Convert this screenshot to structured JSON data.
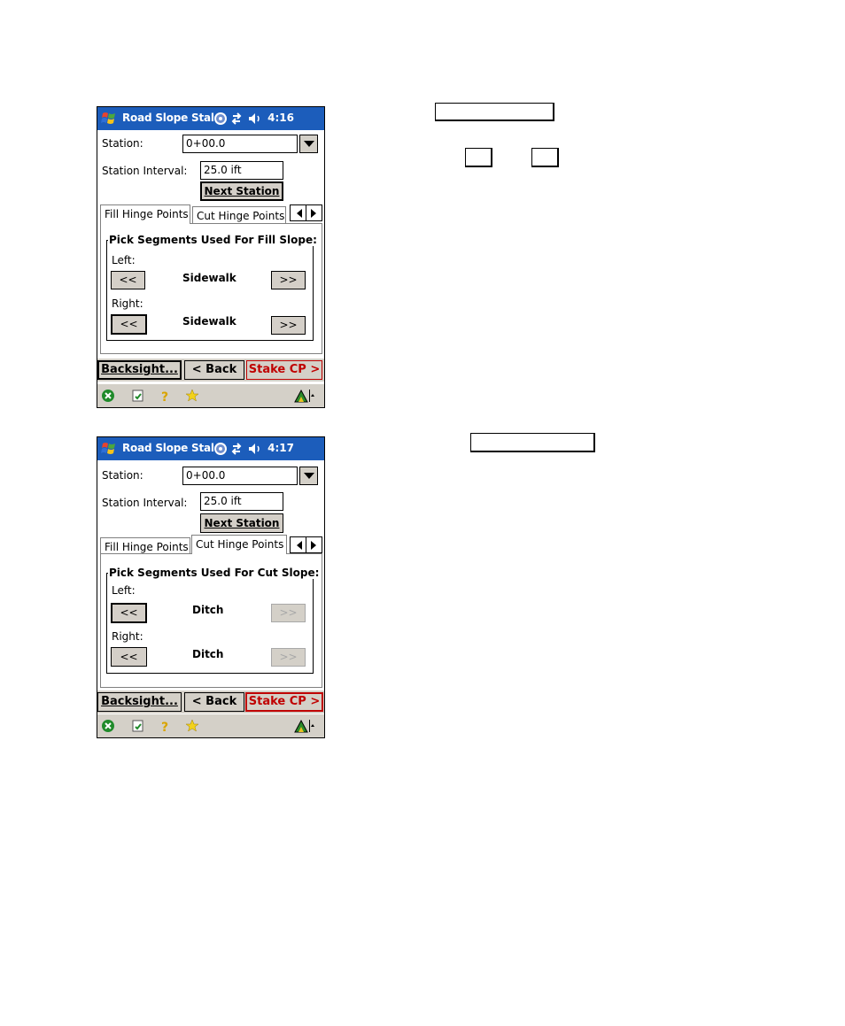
{
  "colors": {
    "titlebar": "#1c5dbb",
    "button_face": "#d4cfc8",
    "stake_text": "#c00000"
  },
  "screens": [
    {
      "app_title": "Road Slope Stal",
      "clock": "4:16",
      "station_label": "Station:",
      "station_value": "0+00.0",
      "interval_label": "Station Interval:",
      "interval_value": "25.0 ift",
      "next_station_label": "Next Station",
      "tabs": [
        "Fill Hinge Points",
        "Cut Hinge Points"
      ],
      "active_tab": "Fill Hinge Points",
      "group_title": "Pick Segments Used For Fill Slope:",
      "left_label": "Left:",
      "left_segment": "Sidewalk",
      "right_label": "Right:",
      "right_segment": "Sidewalk",
      "prev_label": "<<",
      "next_label": ">>",
      "backsight_label": "Backsight...",
      "back_label": "< Back",
      "stake_label": "Stake CP >"
    },
    {
      "app_title": "Road Slope Stal",
      "clock": "4:17",
      "station_label": "Station:",
      "station_value": "0+00.0",
      "interval_label": "Station Interval:",
      "interval_value": "25.0 ift",
      "next_station_label": "Next Station",
      "tabs": [
        "Fill Hinge Points",
        "Cut Hinge Points"
      ],
      "active_tab": "Cut Hinge Points",
      "group_title": "Pick Segments Used For Cut Slope:",
      "left_label": "Left:",
      "left_segment": "Ditch",
      "right_label": "Right:",
      "right_segment": "Ditch",
      "prev_label": "<<",
      "next_label": ">>",
      "backsight_label": "Backsight...",
      "back_label": "< Back",
      "stake_label": "Stake CP >"
    }
  ],
  "icons": {
    "start": "windows-flag-icon",
    "connectivity": "connectivity-icon",
    "sync": "sync-arrows-icon",
    "volume": "speaker-icon",
    "close": "close-icon",
    "tasks": "checklist-icon",
    "help": "help-icon",
    "favorites": "star-icon",
    "sip": "input-panel-icon"
  }
}
